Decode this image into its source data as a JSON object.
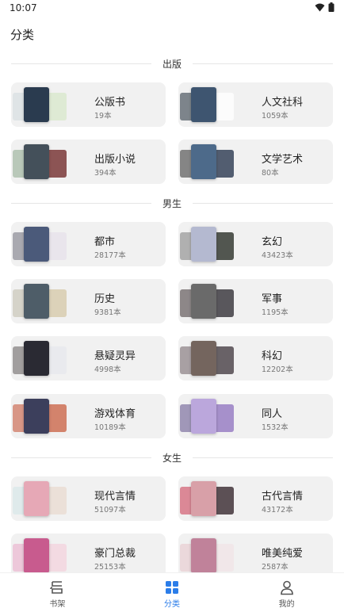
{
  "status": {
    "time": "10:07"
  },
  "page": {
    "title": "分类"
  },
  "sections": [
    {
      "label": "出版"
    },
    {
      "label": "男生"
    },
    {
      "label": "女生"
    }
  ],
  "cards": [
    {
      "name": "公版书",
      "count": "19本",
      "colors": [
        "#cfd9dc",
        "#d7e7c9",
        "#2a3b4f"
      ]
    },
    {
      "name": "人文社科",
      "count": "1059本",
      "colors": [
        "#1e2a36",
        "#ffffff",
        "#3e5570"
      ]
    },
    {
      "name": "出版小说",
      "count": "394本",
      "colors": [
        "#8aa68a",
        "#6a1f1f",
        "#44505a"
      ]
    },
    {
      "name": "文学艺术",
      "count": "80本",
      "colors": [
        "#2c2c2c",
        "#1c2b44",
        "#4d6a8a"
      ]
    },
    {
      "name": "都市",
      "count": "28177本",
      "colors": [
        "#6d6d7a",
        "#e6e0ea",
        "#4b5a7a"
      ]
    },
    {
      "name": "玄幻",
      "count": "43423本",
      "colors": [
        "#7a7a7a",
        "#1c2119",
        "#b4b9d0"
      ]
    },
    {
      "name": "历史",
      "count": "9381本",
      "colors": [
        "#bdb9a8",
        "#d4c7a6",
        "#4e5d68"
      ]
    },
    {
      "name": "军事",
      "count": "1195本",
      "colors": [
        "#3a2f32",
        "#26232a",
        "#6a6a6a"
      ]
    },
    {
      "name": "悬疑灵异",
      "count": "4998本",
      "colors": [
        "#5f5a5a",
        "#e5e7ec",
        "#2a2a33"
      ]
    },
    {
      "name": "科幻",
      "count": "12202本",
      "colors": [
        "#6b5d62",
        "#3b3138",
        "#74655e"
      ]
    },
    {
      "name": "游戏体育",
      "count": "10189本",
      "colors": [
        "#c24a2d",
        "#c85d3f",
        "#3c3f5c"
      ]
    },
    {
      "name": "同人",
      "count": "1532本",
      "colors": [
        "#5c4c88",
        "#8c6fbd",
        "#bba7dc"
      ]
    },
    {
      "name": "现代言情",
      "count": "51097本",
      "colors": [
        "#cfe3e5",
        "#e8d9cf",
        "#e6a8b6"
      ]
    },
    {
      "name": "古代言情",
      "count": "43172本",
      "colors": [
        "#c8324a",
        "#2a1a20",
        "#d8a0a8"
      ]
    },
    {
      "name": "豪门总裁",
      "count": "25153本",
      "colors": [
        "#e9a6c6",
        "#f3d1dc",
        "#c85b8e"
      ]
    },
    {
      "name": "唯美纯爱",
      "count": "2587本",
      "colors": [
        "#e5c2c8",
        "#f0e3e6",
        "#c0829a"
      ]
    }
  ],
  "tabs": [
    {
      "label": "书架",
      "icon": "bookshelf-icon",
      "active": false
    },
    {
      "label": "分类",
      "icon": "grid-icon",
      "active": true
    },
    {
      "label": "我的",
      "icon": "person-icon",
      "active": false
    }
  ],
  "colors": {
    "accent": "#2b7de9",
    "card_bg": "#f1f1f1"
  }
}
